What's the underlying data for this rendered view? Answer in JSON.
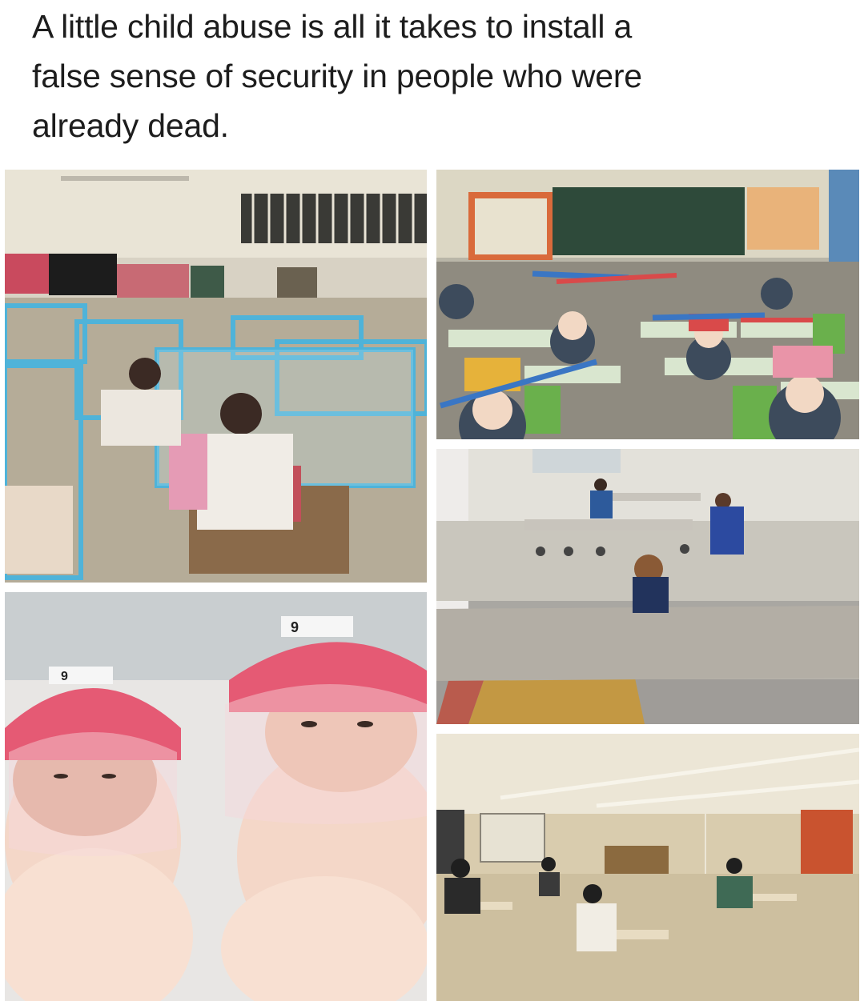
{
  "caption": {
    "line1": "A little child abuse is all it takes to install a",
    "line2": "false sense of security in people who were",
    "line3": "already dead."
  },
  "photos": {
    "classroom_boxes": {
      "desc": "children seated inside plastic box partitions at desks"
    },
    "classroom_hats": {
      "desc": "children wearing distancing hats with long brims at desks"
    },
    "cafeteria": {
      "desc": "children eating at widely spaced cafeteria tables"
    },
    "newborns": {
      "desc": "two swaddled newborns wearing pink face shields",
      "shield_label": "9"
    },
    "spaced_classroom": {
      "desc": "masked students at widely spaced single desks"
    }
  },
  "colors": {
    "caption_text": "#1d1d1d",
    "background": "#ffffff"
  }
}
